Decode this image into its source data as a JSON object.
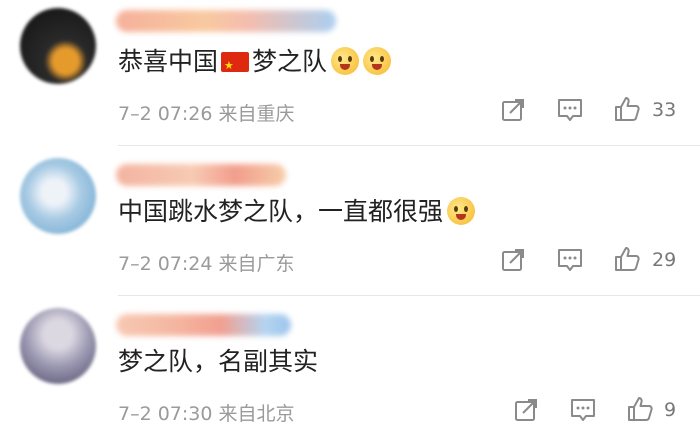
{
  "comments": [
    {
      "text": "恭喜中国",
      "text_after_flag": "梦之队",
      "has_flag": true,
      "emoji_count": 2,
      "time": "7–2 07:26",
      "location": "来自重庆",
      "likes": "33",
      "avatar_colors": [
        "#1a1a1a",
        "#e59a2c"
      ]
    },
    {
      "text": "中国跳水梦之队，一直都很强",
      "has_flag": false,
      "emoji_count": 1,
      "time": "7–2 07:24",
      "location": "来自广东",
      "likes": "29",
      "avatar_colors": [
        "#9cc3e0",
        "#e7edf4"
      ]
    },
    {
      "text": "梦之队，名副其实",
      "has_flag": false,
      "emoji_count": 0,
      "time": "7–2 07:30",
      "location": "来自北京",
      "likes": "9",
      "avatar_colors": [
        "#8e8aa6",
        "#d7d2dc"
      ]
    }
  ],
  "icons": {
    "share": "share-icon",
    "comment": "comment-icon",
    "like": "thumbs-up-icon",
    "emoji": "grinning-face-emoji",
    "flag": "china-flag-emoji"
  }
}
